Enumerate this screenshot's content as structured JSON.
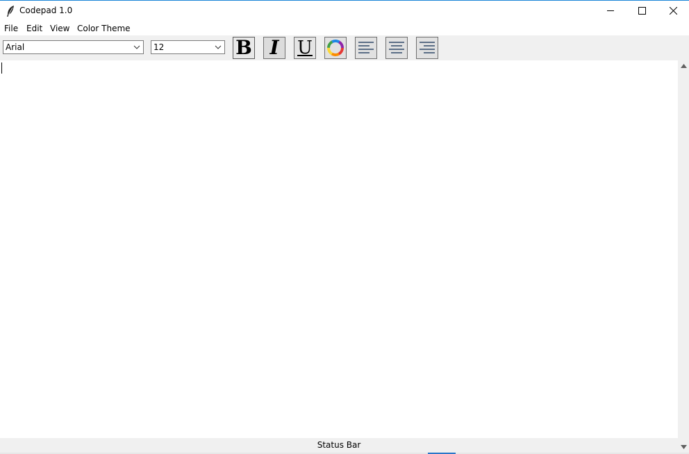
{
  "window": {
    "title": "Codepad 1.0",
    "accent_color": "#1883d7"
  },
  "menubar": {
    "items": [
      {
        "label": "File"
      },
      {
        "label": "Edit"
      },
      {
        "label": "View"
      },
      {
        "label": "Color Theme"
      }
    ]
  },
  "toolbar": {
    "font_family": {
      "value": "Arial"
    },
    "font_size": {
      "value": "12"
    },
    "buttons": [
      {
        "icon": "bold-icon",
        "glyph": "B"
      },
      {
        "icon": "italic-icon",
        "glyph": "I"
      },
      {
        "icon": "underline-icon",
        "glyph": "U"
      },
      {
        "icon": "color-wheel-icon"
      },
      {
        "icon": "align-left-icon"
      },
      {
        "icon": "align-center-icon"
      },
      {
        "icon": "align-right-icon"
      }
    ]
  },
  "editor": {
    "content": ""
  },
  "statusbar": {
    "text": "Status Bar"
  }
}
